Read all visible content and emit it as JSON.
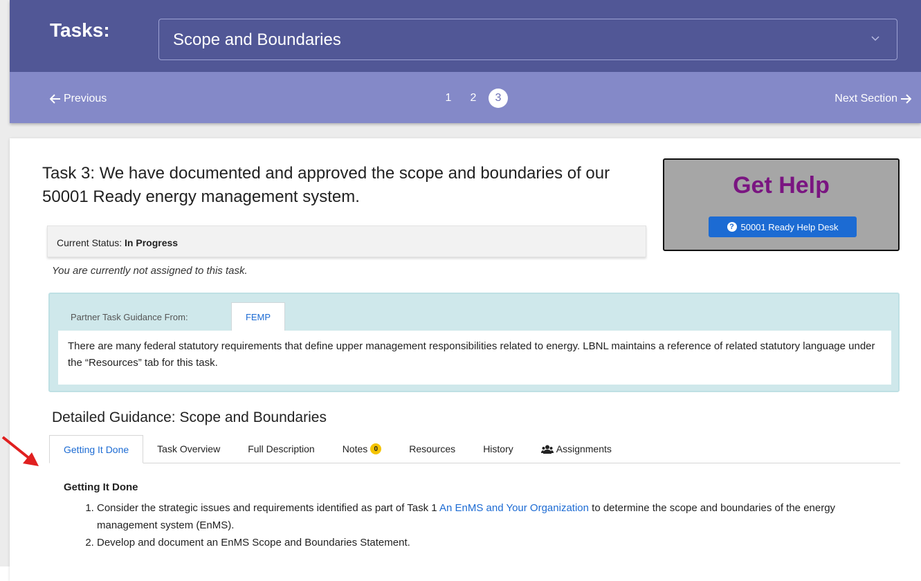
{
  "header": {
    "tasks_label": "Tasks:",
    "selected_task": "Scope and Boundaries",
    "prev_label": "Previous",
    "next_label": "Next Section",
    "pages": [
      "1",
      "2",
      "3"
    ],
    "active_page": "3"
  },
  "task": {
    "title": "Task 3: We have documented and approved the scope and boundaries of our 50001 Ready energy management system.",
    "status_label": "Current Status:",
    "status_value": "In Progress",
    "assignment_note": "You are currently not assigned to this task."
  },
  "help": {
    "title": "Get Help",
    "button_label": "50001 Ready Help Desk"
  },
  "partner": {
    "label": "Partner Task Guidance From:",
    "tab": "FEMP",
    "text": "There are many federal statutory requirements that define upper management responsibilities related to energy. LBNL maintains a reference of related statutory language under the “Resources” tab for this task."
  },
  "guidance": {
    "heading": "Detailed Guidance: Scope and Boundaries",
    "tabs": [
      "Getting It Done",
      "Task Overview",
      "Full Description",
      "Notes",
      "Resources",
      "History",
      "Assignments"
    ],
    "notes_count": "0",
    "section_title": "Getting It Done",
    "step1_before": "Consider the strategic issues and requirements identified as part of Task 1 ",
    "step1_link": "An EnMS and Your Organization",
    "step1_after": " to determine the scope and boundaries of the energy management system (EnMS).",
    "step2": "Develop and document an EnMS Scope and Boundaries Statement."
  },
  "colors": {
    "task_bar": "#515796",
    "pager_bar": "#8489c8",
    "help_title": "#7a1581",
    "link": "#1c6bd3",
    "arrow": "#e02020"
  }
}
